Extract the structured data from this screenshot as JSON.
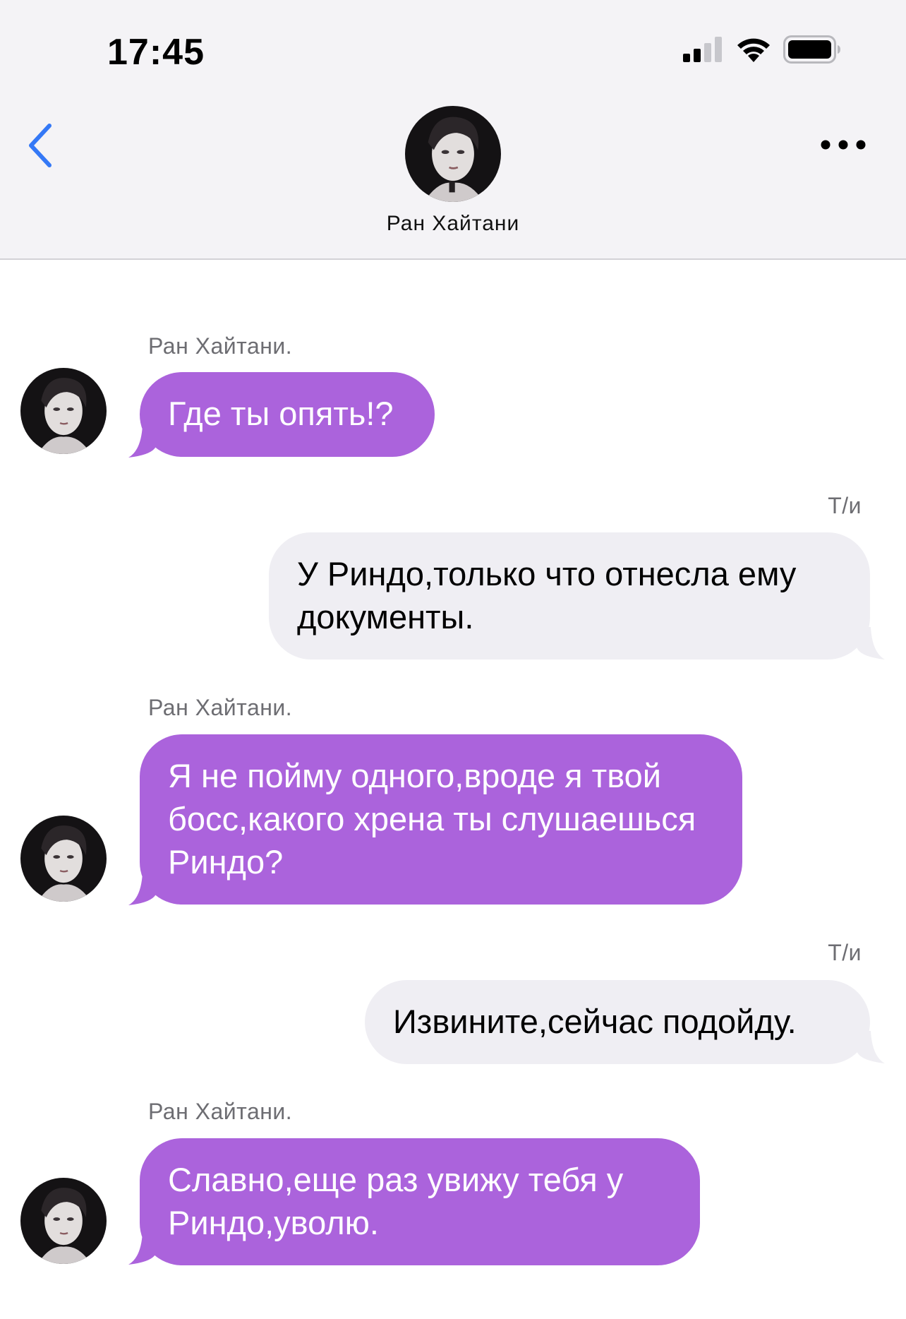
{
  "status_bar": {
    "time": "17:45"
  },
  "header": {
    "contact_name": "Ран Хайтани"
  },
  "messages": [
    {
      "direction": "in",
      "sender": "Ран Хайтани.",
      "text": "Где ты опять!?"
    },
    {
      "direction": "out",
      "sender": "Т/и",
      "text": "У Риндо,только что отнесла ему документы."
    },
    {
      "direction": "in",
      "sender": "Ран Хайтани.",
      "text": "Я не пойму одного,вроде я твой босс,какого хрена ты слушаешься Риндо?"
    },
    {
      "direction": "out",
      "sender": "Т/и",
      "text": "Извините,сейчас подойду."
    },
    {
      "direction": "in",
      "sender": "Ран Хайтани.",
      "text": "Славно,еще раз увижу тебя у Риндо,уволю."
    }
  ],
  "colors": {
    "incoming_bubble": "#ab63dc",
    "outgoing_bubble": "#efeef3",
    "header_background": "#f4f3f6",
    "back_chevron": "#3478f6"
  },
  "icons": {
    "back": "chevron-left-icon",
    "more": "ellipsis-icon",
    "signal": "cellular-signal-icon",
    "wifi": "wifi-icon",
    "battery": "battery-icon"
  }
}
